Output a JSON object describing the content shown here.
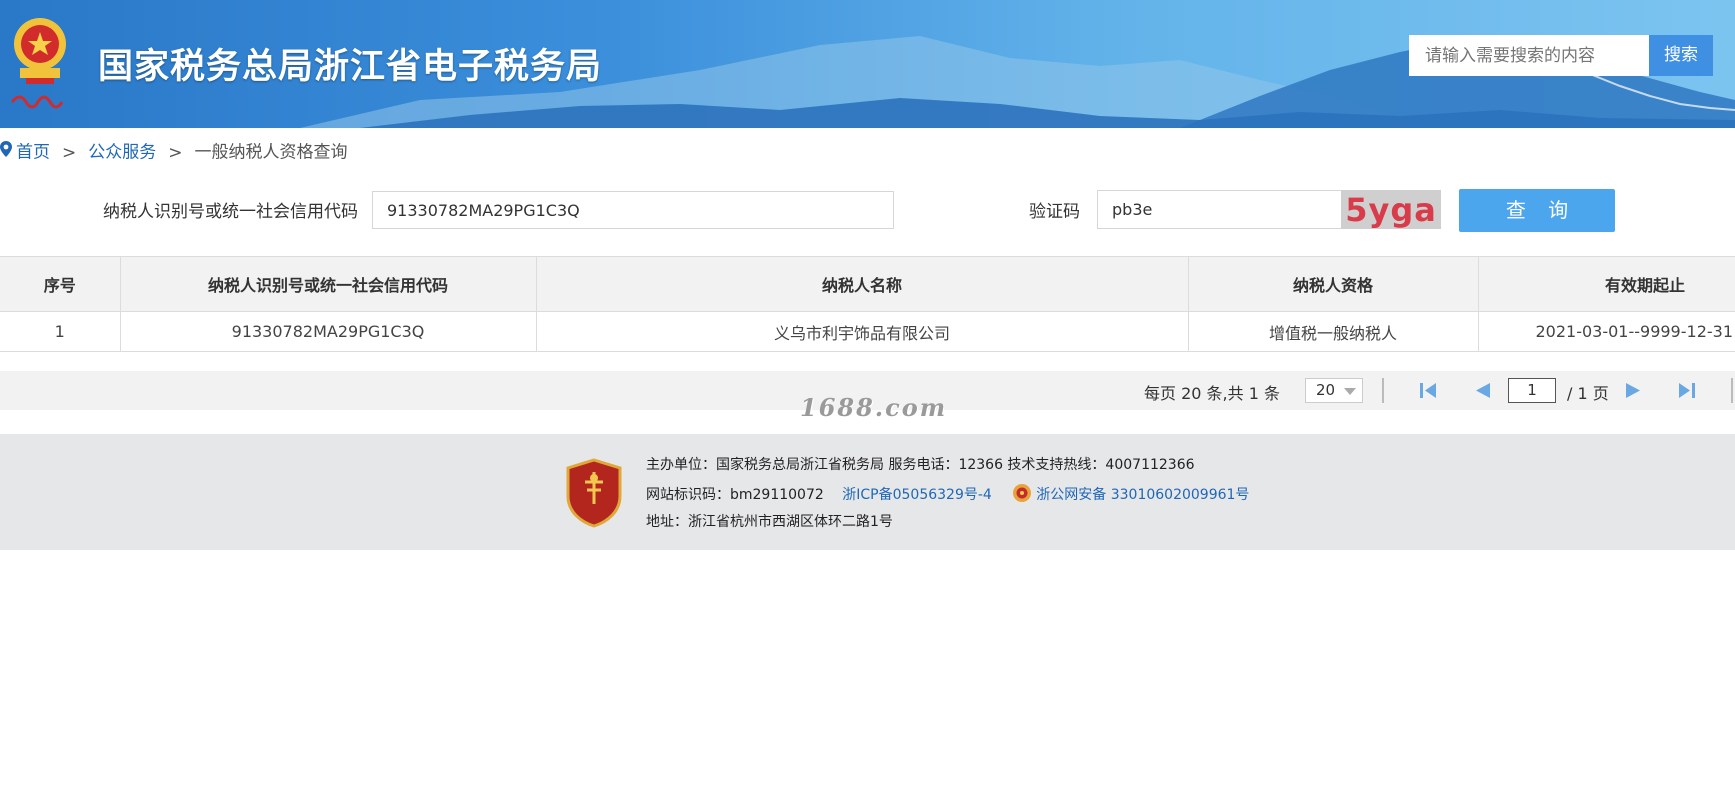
{
  "header": {
    "site_title": "国家税务总局浙江省电子税务局",
    "search_placeholder": "请输入需要搜索的内容",
    "search_button": "搜索",
    "emblem_text": "中国税务"
  },
  "breadcrumb": {
    "home": "首页",
    "separator": ">",
    "public_services": "公众服务",
    "current": "一般纳税人资格查询"
  },
  "query": {
    "taxpayer_id_label": "纳税人识别号或统一社会信用代码",
    "taxpayer_id_value": "91330782MA29PG1C3Q",
    "captcha_label": "验证码",
    "captcha_value": "pb3e",
    "captcha_image_text": "5yga",
    "submit_button": "查 询"
  },
  "table": {
    "headers": [
      "序号",
      "纳税人识别号或统一社会信用代码",
      "纳税人名称",
      "纳税人资格",
      "有效期起止"
    ],
    "rows": [
      [
        "1",
        "91330782MA29PG1C3Q",
        "义乌市利宇饰品有限公司",
        "增值税一般纳税人",
        "2021-03-01--9999-12-31"
      ]
    ]
  },
  "pager": {
    "summary": "每页 20 条,共 1 条",
    "page_size": "20",
    "current_page": "1",
    "total_pages": "/ 1 页"
  },
  "watermark": "1688.com",
  "footer": {
    "badge_text": "党政机关",
    "line1": "主办单位：国家税务总局浙江省税务局     服务电话：12366     技术支持热线：4007112366",
    "site_id": "网站标识码：bm29110072",
    "icp": "浙ICP备05056329号-4",
    "police": "浙公网安备 33010602009961号",
    "address": "地址：浙江省杭州市西湖区体环二路1号"
  },
  "colors": {
    "header_blue": "#3b8fdb",
    "link_blue": "#1f67b7",
    "query_button": "#4ca6ee",
    "captcha_text": "#d83b4a"
  }
}
